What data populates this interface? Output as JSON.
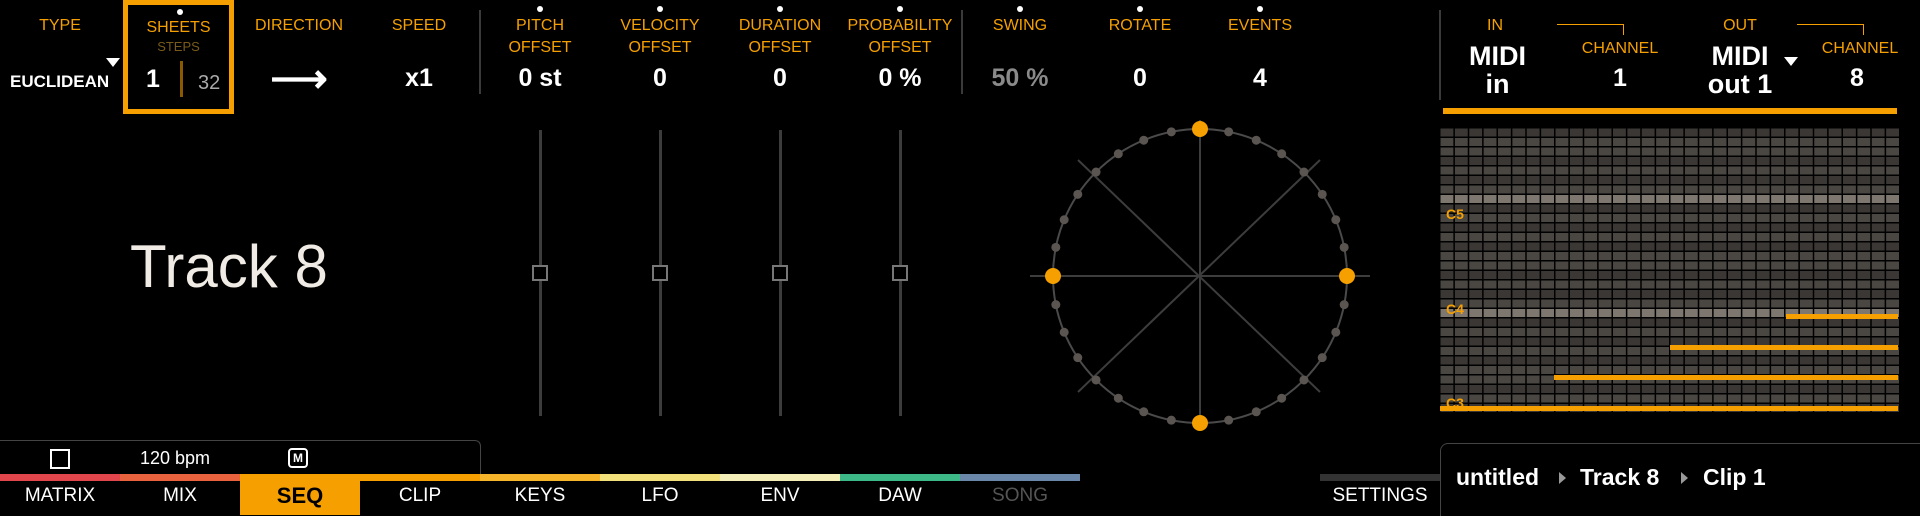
{
  "colors": {
    "accent": "#f5a000",
    "background": "#000000"
  },
  "params": [
    {
      "id": "type",
      "header": "TYPE",
      "value": "EUCLIDEAN"
    },
    {
      "id": "sheets",
      "header": "SHEETS",
      "subheader": "STEPS",
      "value": "1",
      "value2": "32"
    },
    {
      "id": "direction",
      "header": "DIRECTION",
      "value": "⟶"
    },
    {
      "id": "speed",
      "header": "SPEED",
      "value": "x1"
    },
    {
      "id": "pitch",
      "header": "PITCH",
      "header2": "OFFSET",
      "value": "0 st"
    },
    {
      "id": "velocity",
      "header": "VELOCITY",
      "header2": "OFFSET",
      "value": "0"
    },
    {
      "id": "duration",
      "header": "DURATION",
      "header2": "OFFSET",
      "value": "0"
    },
    {
      "id": "probability",
      "header": "PROBABILITY",
      "header2": "OFFSET",
      "value": "0 %"
    },
    {
      "id": "swing",
      "header": "SWING",
      "value": "50 %"
    },
    {
      "id": "rotate",
      "header": "ROTATE",
      "value": "0"
    },
    {
      "id": "events",
      "header": "EVENTS",
      "value": "4"
    }
  ],
  "track_name": "Track 8",
  "midi": {
    "in_header": "IN",
    "in_value1": "MIDI",
    "in_value2": "in",
    "in_channel_header": "CHANNEL",
    "in_channel": "1",
    "out_header": "OUT",
    "out_value1": "MIDI",
    "out_value2": "out 1",
    "out_channel_header": "CHANNEL",
    "out_channel": "8"
  },
  "piano_roll": {
    "labels": [
      "C5",
      "C4",
      "C3"
    ]
  },
  "transport": {
    "bpm": "120 bpm",
    "metronome": "M"
  },
  "tabs": [
    {
      "label": "MATRIX",
      "color": "#e0464b"
    },
    {
      "label": "MIX",
      "color": "#e9623e"
    },
    {
      "label": "SEQ",
      "color": "#f5a000",
      "active": true
    },
    {
      "label": "CLIP",
      "color": "#f5a000"
    },
    {
      "label": "KEYS",
      "color": "#f7b52c"
    },
    {
      "label": "LFO",
      "color": "#f2e07a"
    },
    {
      "label": "ENV",
      "color": "#f4efb8"
    },
    {
      "label": "DAW",
      "color": "#3db887"
    },
    {
      "label": "SONG",
      "color": "#6a86a8",
      "dim": true
    }
  ],
  "settings_label": "SETTINGS",
  "breadcrumb": {
    "project": "untitled",
    "track": "Track 8",
    "clip": "Clip 1"
  }
}
